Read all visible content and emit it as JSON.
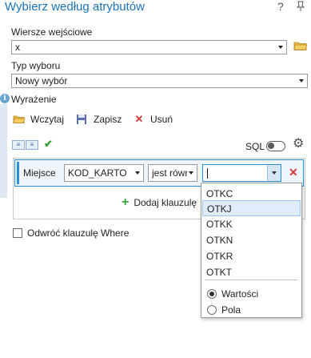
{
  "title": "Wybierz według atrybutów",
  "window": {
    "help_label": "?",
    "pin_icon": "pin-icon"
  },
  "input_rows": {
    "label": "Wiersze wejściowe",
    "value": "x"
  },
  "selection_type": {
    "label": "Typ wyboru",
    "value": "Nowy wybór"
  },
  "expression": {
    "label": "Wyrażenie",
    "toolbar": {
      "load_label": "Wczytaj",
      "save_label": "Zapisz",
      "remove_label": "Usuń"
    },
    "sql_label": "SQL",
    "sql_enabled": false
  },
  "clause": {
    "where_label": "Miejsce",
    "field_value": "KOD_KARTO",
    "operator_value": "jest równ",
    "value_text": ""
  },
  "add_clause_label": "Dodaj klauzulę",
  "invert_label": "Odwróć klauzulę Where",
  "invert_checked": false,
  "dropdown": {
    "options": [
      "OTKC",
      "OTKJ",
      "OTKK",
      "OTKN",
      "OTKR",
      "OTKT"
    ],
    "selected": "OTKJ",
    "mode_values_label": "Wartości",
    "mode_fields_label": "Pola",
    "mode_selected": "Wartości"
  },
  "colors": {
    "title": "#1c73b8",
    "accent": "#2a8fd8",
    "remove": "#d23a3a",
    "add": "#3aa13a"
  }
}
